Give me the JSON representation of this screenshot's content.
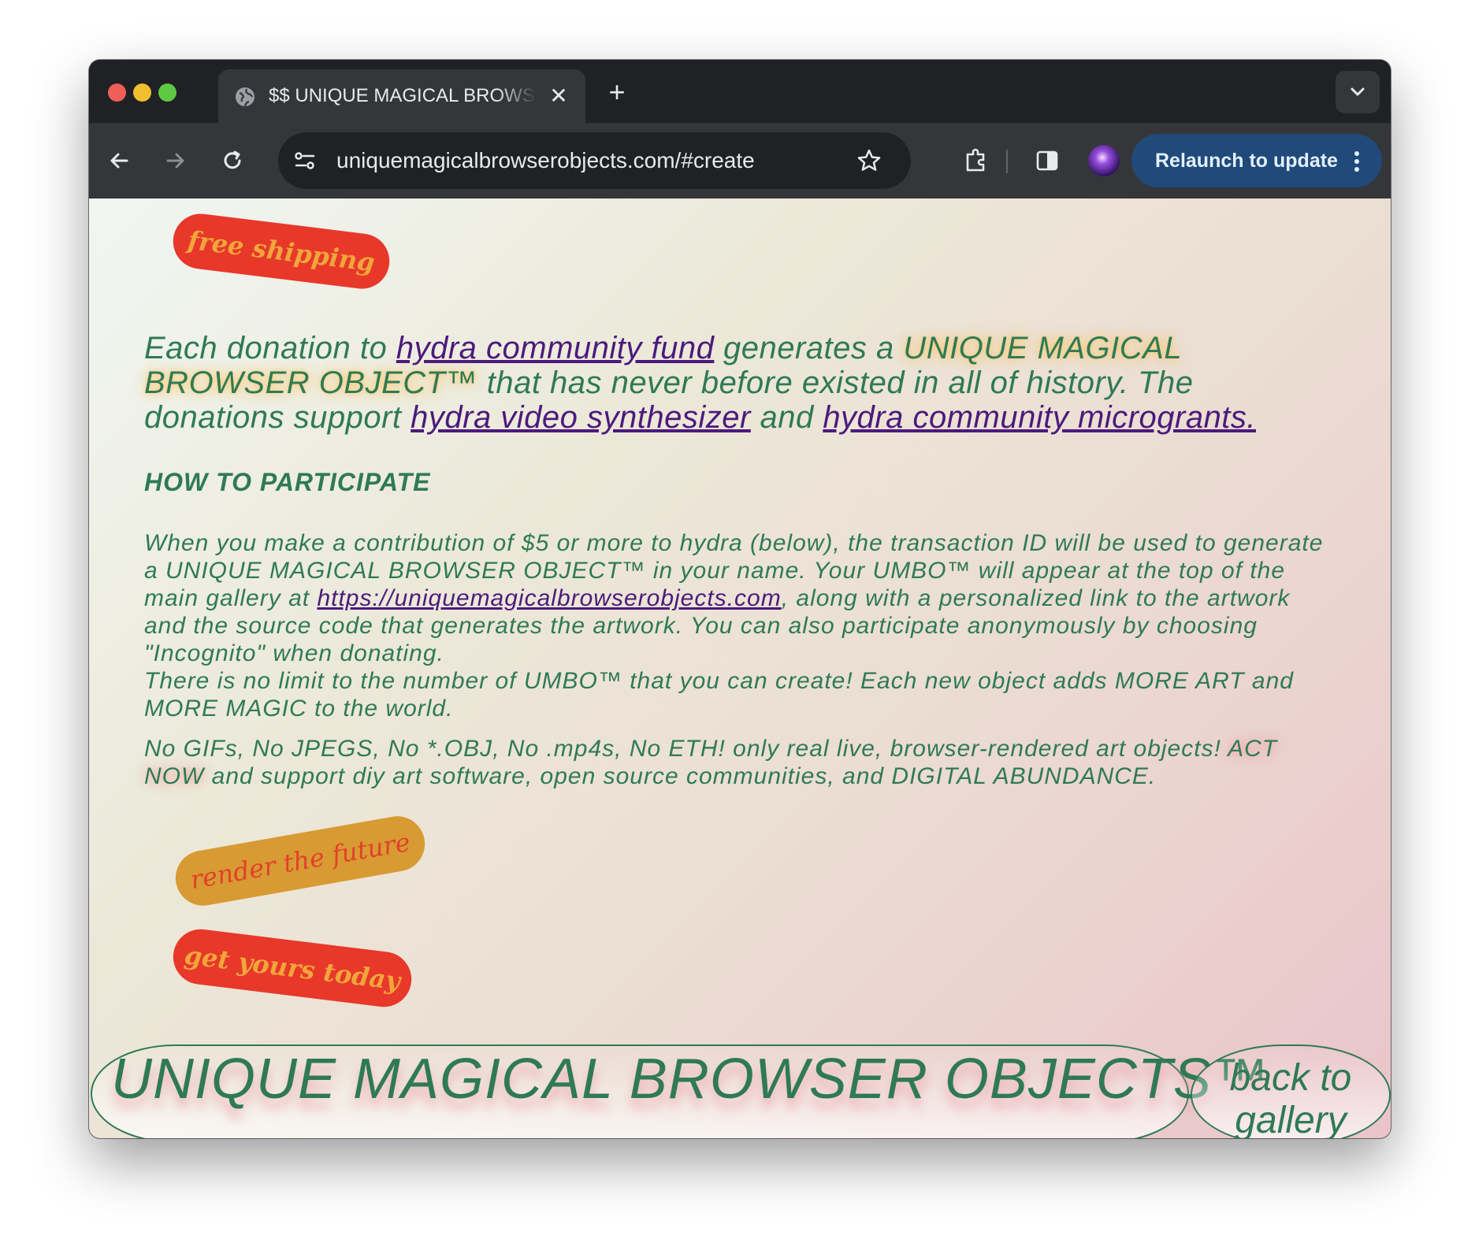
{
  "browser": {
    "tab_title": "$$ UNIQUE MAGICAL BROWSER OBJECTS",
    "tab_close": "✕",
    "new_tab": "+",
    "url": "uniquemagicalbrowserobjects.com/#create",
    "relaunch_label": "Relaunch to update",
    "icons": [
      "back-arrow-icon",
      "forward-arrow-icon",
      "reload-icon",
      "site-settings-icon",
      "bookmark-star-icon",
      "extensions-icon",
      "side-panel-icon",
      "profile-avatar-icon",
      "more-menu-icon",
      "tab-search-icon"
    ]
  },
  "stickers": {
    "free_shipping": "free shipping",
    "render_future": "render the future",
    "get_yours": "get yours today"
  },
  "intro": {
    "p1": "Each donation to ",
    "link_fund": "hydra community fund",
    "p2": " generates a ",
    "highlight": "UNIQUE MAGICAL BROWSER OBJECT™",
    "p3": " that has never before existed in all of history. The donations support ",
    "link_synth": "hydra video synthesizer",
    "p4": " and ",
    "link_grants": "hydra community microgrants."
  },
  "how_to": {
    "heading": "HOW TO PARTICIPATE",
    "para1_a": "When you make a contribution of $5 or more to hydra (below), the transaction ID will be used to generate a UNIQUE MAGICAL BROWSER OBJECT™ in your name. Your UMBO™ will appear at the top of the main gallery at ",
    "para1_link": "https://uniquemagicalbrowserobjects.com",
    "para1_b": ", along with a personalized link to the artwork and the source code that generates the artwork. You can also participate anonymously by choosing \"Incognito\" when donating.",
    "para2": "There is no limit to the number of UMBO™ that you can create! Each new object adds MORE ART and MORE MAGIC to the world.",
    "para3_a": "No GIFs, No JPEGS, No *.OBJ, No .mp4s, No ETH! only real live, browser-rendered art objects! ",
    "para3_highlight": "ACT NOW",
    "para3_b": " and support diy art software, open source communities, and DIGITAL ABUNDANCE."
  },
  "footer": {
    "title": "UNIQUE MAGICAL BROWSER OBJECTS™",
    "back_line1": "back to",
    "back_line2": "gallery"
  },
  "colors": {
    "text_green": "#2f7a55",
    "link_purple": "#4b1a7c",
    "sticker_red": "#e8382a",
    "sticker_orange": "#d89a32",
    "relaunch_blue": "#1f4a7a"
  }
}
